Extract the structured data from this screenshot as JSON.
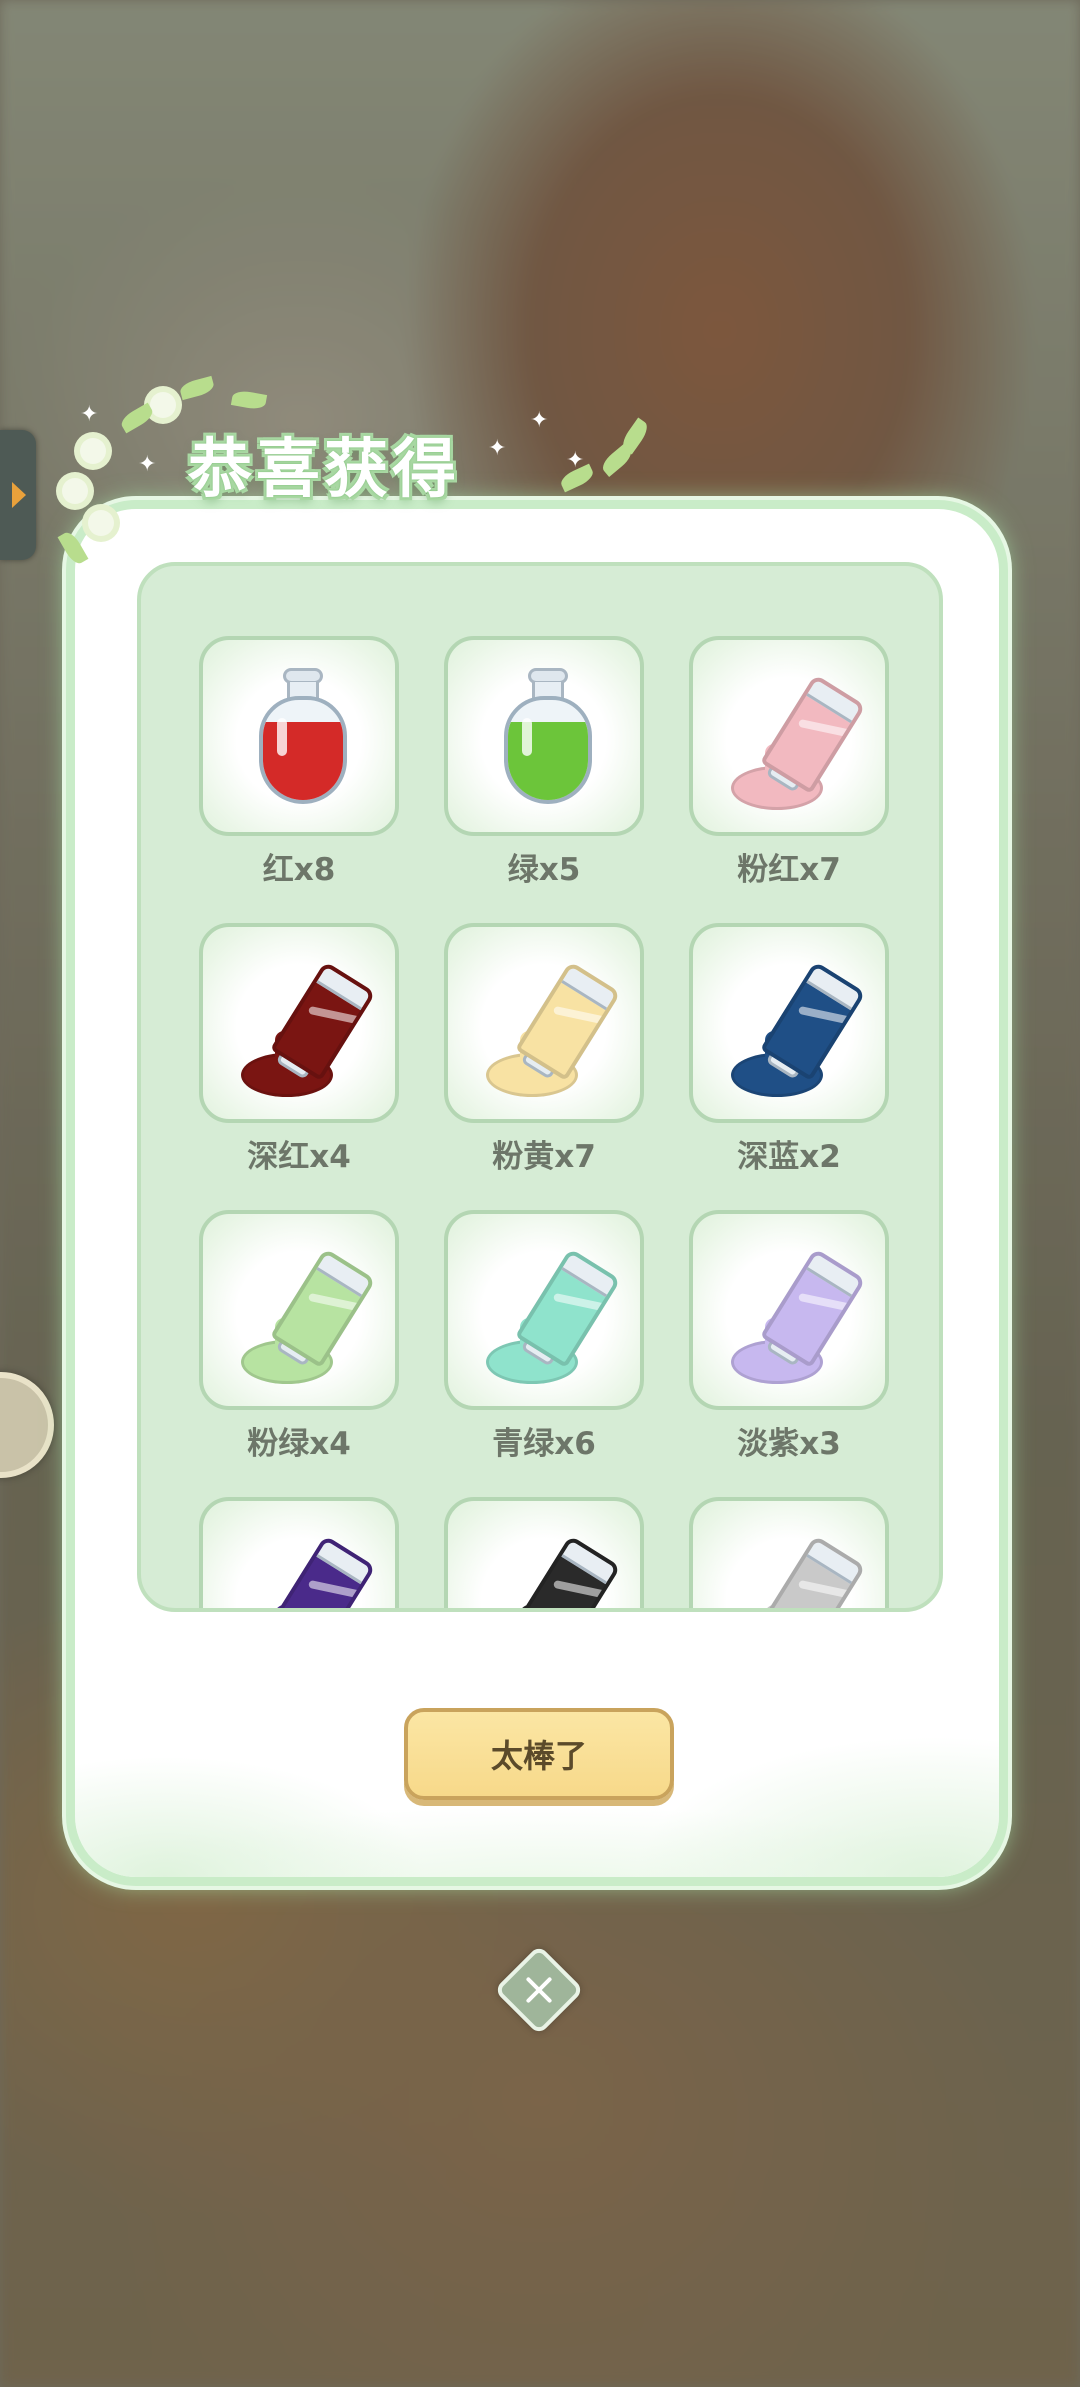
{
  "dialog": {
    "title": "恭喜获得",
    "confirm_label": "太棒了",
    "close_icon": "close-icon"
  },
  "items": [
    {
      "label": "红x8",
      "type": "potion",
      "color": "#d42a28"
    },
    {
      "label": "绿x5",
      "type": "potion",
      "color": "#6cc53a"
    },
    {
      "label": "粉红x7",
      "type": "tube",
      "color": "#f2b9c0"
    },
    {
      "label": "深红x4",
      "type": "tube",
      "color": "#7a1512"
    },
    {
      "label": "粉黄x7",
      "type": "tube",
      "color": "#f8e2a3"
    },
    {
      "label": "深蓝x2",
      "type": "tube",
      "color": "#1f4f86"
    },
    {
      "label": "粉绿x4",
      "type": "tube",
      "color": "#b7e3a1"
    },
    {
      "label": "青绿x6",
      "type": "tube",
      "color": "#8fe3cc"
    },
    {
      "label": "淡紫x3",
      "type": "tube",
      "color": "#c7b8ef"
    },
    {
      "label": "",
      "type": "tube",
      "color": "#4a2a8a"
    },
    {
      "label": "",
      "type": "tube",
      "color": "#2a2a2a"
    },
    {
      "label": "",
      "type": "tube",
      "color": "#c9c9c9"
    }
  ]
}
